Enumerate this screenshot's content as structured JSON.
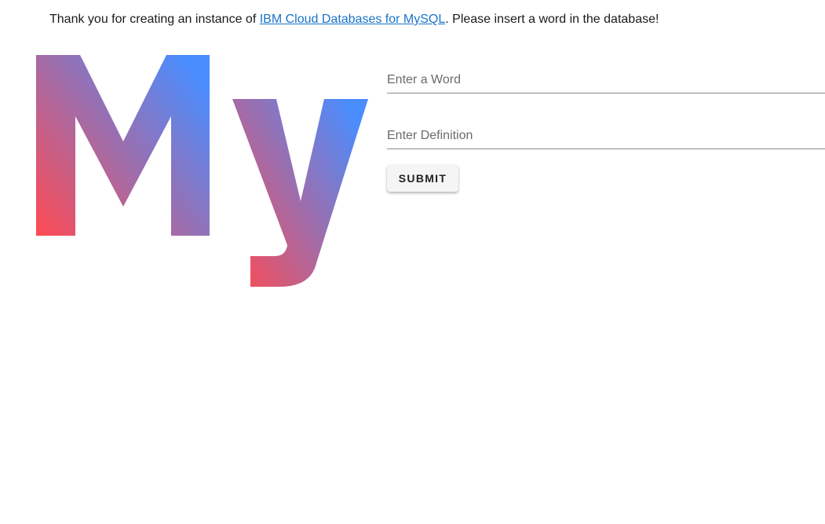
{
  "intro": {
    "before": "Thank you for creating an instance of ",
    "link": "IBM Cloud Databases for MySQL",
    "after": ". Please insert a word in the database!"
  },
  "logo": {
    "text": "My",
    "gradient": [
      "#ff4a52",
      "#9a6fb0",
      "#4a8dff"
    ]
  },
  "form": {
    "word_placeholder": "Enter a Word",
    "definition_placeholder": "Enter Definition",
    "submit_label": "SUBMIT"
  }
}
